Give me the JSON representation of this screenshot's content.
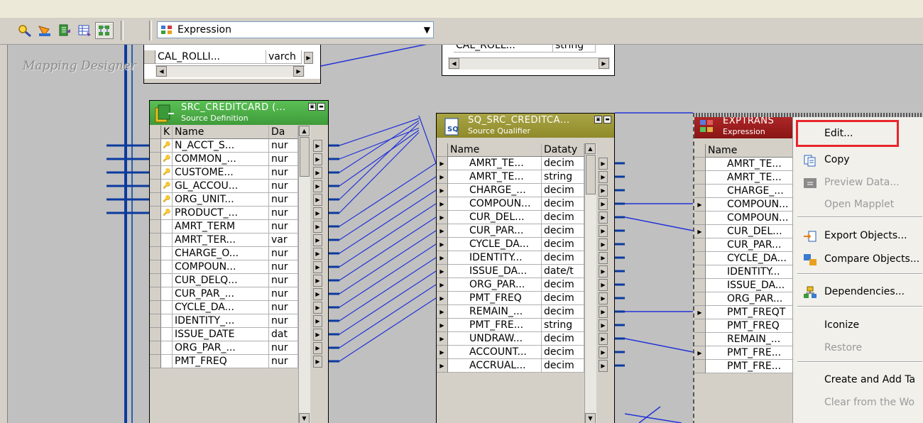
{
  "toolbar": {
    "icons": [
      "find-icon",
      "navigate-icon",
      "edit-icon",
      "table-icon",
      "arrange-icon"
    ],
    "transformation_type_icon": "expression-transform-icon",
    "transformation_select": "Expression"
  },
  "canvas": {
    "label": "Mapping Designer",
    "top_left_fragment": {
      "col1": "CAL_ROLLI...",
      "col2": "varch"
    },
    "top_right_fragment": {
      "col1": "CAL_ROLL...",
      "col2": "string"
    }
  },
  "source_definition": {
    "title": "SRC_CREDITCARD (...",
    "subtitle": "Source Definition",
    "headers": {
      "key": "K",
      "name": "Name",
      "type": "Da"
    },
    "rows": [
      {
        "key": true,
        "name": "N_ACCT_S...",
        "type": "nur"
      },
      {
        "key": true,
        "name": "COMMON_...",
        "type": "nur"
      },
      {
        "key": true,
        "name": "CUSTOME...",
        "type": "nur"
      },
      {
        "key": true,
        "name": "GL_ACCOU...",
        "type": "nur"
      },
      {
        "key": true,
        "name": "ORG_UNIT...",
        "type": "nur"
      },
      {
        "key": true,
        "name": "PRODUCT_...",
        "type": "nur"
      },
      {
        "key": false,
        "name": "AMRT_TERM",
        "type": "nur"
      },
      {
        "key": false,
        "name": "AMRT_TER...",
        "type": "var"
      },
      {
        "key": false,
        "name": "CHARGE_O...",
        "type": "nur"
      },
      {
        "key": false,
        "name": "COMPOUN...",
        "type": "nur"
      },
      {
        "key": false,
        "name": "CUR_DELQ...",
        "type": "nur"
      },
      {
        "key": false,
        "name": "CUR_PAR_...",
        "type": "nur"
      },
      {
        "key": false,
        "name": "CYCLE_DA...",
        "type": "nur"
      },
      {
        "key": false,
        "name": "IDENTITY_...",
        "type": "nur"
      },
      {
        "key": false,
        "name": "ISSUE_DATE",
        "type": "dat"
      },
      {
        "key": false,
        "name": "ORG_PAR_...",
        "type": "nur"
      },
      {
        "key": false,
        "name": "PMT_FREQ",
        "type": "nur"
      }
    ]
  },
  "source_qualifier": {
    "title": "SQ_SRC_CREDITCA...",
    "subtitle": "Source Qualifier",
    "headers": {
      "name": "Name",
      "type": "Dataty"
    },
    "rows": [
      {
        "name": "AMRT_TE...",
        "type": "decim"
      },
      {
        "name": "AMRT_TE...",
        "type": "string"
      },
      {
        "name": "CHARGE_...",
        "type": "decim"
      },
      {
        "name": "COMPOUN...",
        "type": "decim"
      },
      {
        "name": "CUR_DEL...",
        "type": "decim"
      },
      {
        "name": "CUR_PAR...",
        "type": "decim"
      },
      {
        "name": "CYCLE_DA...",
        "type": "decim"
      },
      {
        "name": "IDENTITY...",
        "type": "decim"
      },
      {
        "name": "ISSUE_DA...",
        "type": "date/t"
      },
      {
        "name": "ORG_PAR...",
        "type": "decim"
      },
      {
        "name": "PMT_FREQ",
        "type": "decim"
      },
      {
        "name": "REMAIN_...",
        "type": "decim"
      },
      {
        "name": "PMT_FRE...",
        "type": "string"
      },
      {
        "name": "UNDRAW...",
        "type": "decim"
      },
      {
        "name": "ACCOUNT...",
        "type": "decim"
      },
      {
        "name": "ACCRUAL...",
        "type": "decim"
      }
    ]
  },
  "expression": {
    "title": "EXPTRANS",
    "subtitle": "Expression",
    "headers": {
      "name": "Name"
    },
    "rows": [
      {
        "name": "AMRT_TE...",
        "in": false
      },
      {
        "name": "AMRT_TE...",
        "in": false
      },
      {
        "name": "CHARGE_...",
        "in": false
      },
      {
        "name": "COMPOUN...",
        "in": true
      },
      {
        "name": "COMPOUN...",
        "in": false
      },
      {
        "name": "CUR_DEL...",
        "in": true
      },
      {
        "name": "CUR_PAR...",
        "in": false
      },
      {
        "name": "CYCLE_DA...",
        "in": false
      },
      {
        "name": "IDENTITY...",
        "in": false
      },
      {
        "name": "ISSUE_DA...",
        "in": false
      },
      {
        "name": "ORG_PAR...",
        "in": false
      },
      {
        "name": "PMT_FREQT",
        "in": true
      },
      {
        "name": "PMT_FREQ",
        "in": false
      },
      {
        "name": "REMAIN_...",
        "in": false
      },
      {
        "name": "PMT_FRE...",
        "in": true
      },
      {
        "name": "PMT_FRE...",
        "in": false
      }
    ]
  },
  "context_menu": {
    "items": [
      {
        "label": "Edit...",
        "icon": "",
        "disabled": false
      },
      {
        "label": "Copy",
        "icon": "copy-icon",
        "disabled": false
      },
      {
        "label": "Preview Data...",
        "icon": "preview-data-icon",
        "disabled": true
      },
      {
        "label": "Open Mapplet",
        "icon": "",
        "disabled": true
      },
      {
        "label": "Export Objects...",
        "icon": "export-objects-icon",
        "disabled": false
      },
      {
        "label": "Compare Objects...",
        "icon": "compare-objects-icon",
        "disabled": false
      },
      {
        "label": "Dependencies...",
        "icon": "dependencies-icon",
        "disabled": false
      },
      {
        "label": "Iconize",
        "icon": "",
        "disabled": false
      },
      {
        "label": "Restore",
        "icon": "",
        "disabled": true
      },
      {
        "label": "Create and Add Ta",
        "icon": "",
        "disabled": false
      },
      {
        "label": "Clear from the Wo",
        "icon": "",
        "disabled": true
      }
    ]
  },
  "colors": {
    "source_title": "#3f9b3a",
    "qualifier_title": "#8f8a2a",
    "expression_title": "#9b1b1b",
    "link": "#2232d8",
    "port_link": "#0b3a9e",
    "highlight": "#e8262c"
  }
}
